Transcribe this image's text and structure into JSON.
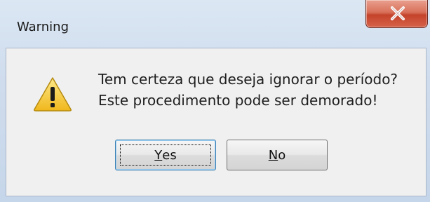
{
  "window": {
    "title": "Warning",
    "close_icon": "close-x-icon"
  },
  "dialog": {
    "icon": "warning-triangle-icon",
    "message_line1": "Tem certeza que deseja ignorar o período?",
    "message_line2": "Este procedimento pode ser demorado!"
  },
  "buttons": {
    "yes_mnemonic": "Y",
    "yes_rest": "es",
    "no_mnemonic": "N",
    "no_rest": "o"
  },
  "colors": {
    "close_button": "#c4432a",
    "warning_icon": "#f2c230",
    "client_background": "#f0f0f0"
  }
}
